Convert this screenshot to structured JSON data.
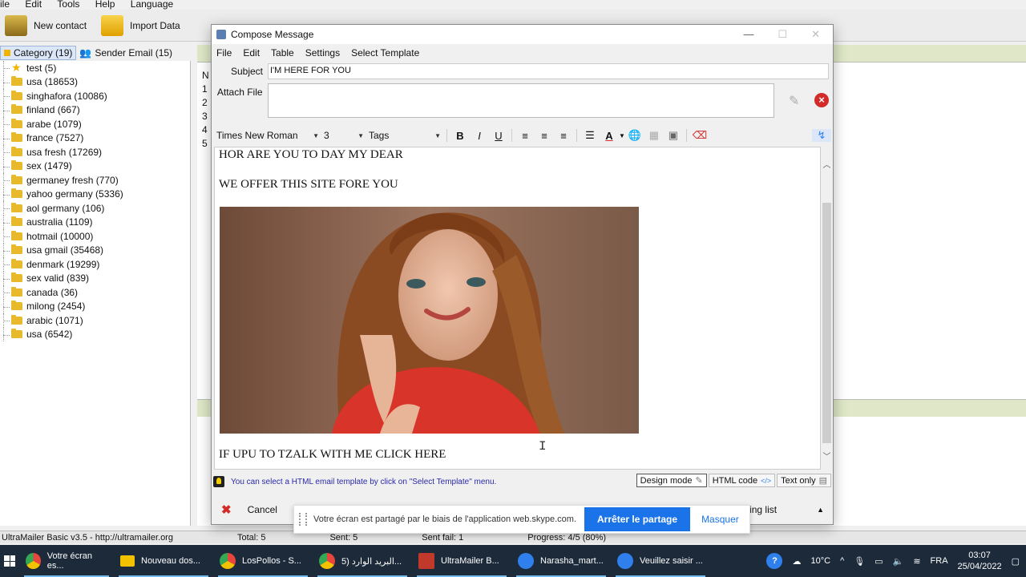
{
  "app_menu": [
    "ile",
    "Edit",
    "Tools",
    "Help",
    "Language"
  ],
  "app_toolbar": [
    {
      "label": "New contact",
      "icon": "new-contact-icon",
      "color": "#c8a43a"
    },
    {
      "label": "Import Data",
      "icon": "import-data-icon",
      "color": "#f2b400"
    }
  ],
  "left_tabs": [
    {
      "label": "Category (19)",
      "icon": "category-icon"
    },
    {
      "label": "Sender Email (15)",
      "icon": "sender-email-icon"
    }
  ],
  "categories": [
    {
      "label": "test  (5)",
      "icon": "star-icon"
    },
    {
      "label": "usa (18653)",
      "icon": "folder-icon"
    },
    {
      "label": "singhafora (10086)",
      "icon": "folder-icon"
    },
    {
      "label": "finland (667)",
      "icon": "folder-icon"
    },
    {
      "label": "arabe (1079)",
      "icon": "folder-icon"
    },
    {
      "label": "france (7527)",
      "icon": "folder-icon"
    },
    {
      "label": "usa fresh (17269)",
      "icon": "folder-icon"
    },
    {
      "label": "sex (1479)",
      "icon": "folder-icon"
    },
    {
      "label": "germaney fresh (770)",
      "icon": "folder-icon"
    },
    {
      "label": "yahoo germany (5336)",
      "icon": "folder-icon"
    },
    {
      "label": "aol germany (106)",
      "icon": "folder-icon"
    },
    {
      "label": "australia (1109)",
      "icon": "folder-icon"
    },
    {
      "label": "hotmail (10000)",
      "icon": "folder-icon"
    },
    {
      "label": "usa gmail (35468)",
      "icon": "folder-icon"
    },
    {
      "label": "denmark (19299)",
      "icon": "folder-icon"
    },
    {
      "label": "sex valid (839)",
      "icon": "folder-icon"
    },
    {
      "label": "canada  (36)",
      "icon": "folder-icon"
    },
    {
      "label": "milong (2454)",
      "icon": "folder-icon"
    },
    {
      "label": "arabic (1071)",
      "icon": "folder-icon"
    },
    {
      "label": "usa (6542)",
      "icon": "folder-icon"
    }
  ],
  "bg_rows": [
    "N",
    "1",
    "2",
    "3",
    "4",
    "5"
  ],
  "compose": {
    "title": "Compose Message",
    "menu": [
      "File",
      "Edit",
      "Table",
      "Settings",
      "Select Template"
    ],
    "subject_label": "Subject",
    "subject_value": "I'M HERE FOR YOU",
    "attach_label": "Attach File",
    "font_family": "Times New Roman",
    "font_size": "3",
    "tags_label": "Tags",
    "body_line1": "HOR ARE YOU TO DAY MY DEAR",
    "body_line2": "WE OFFER THIS SITE FORE YOU",
    "body_line3": "IF UPU TO TZALK  WITH ME CLICK HERE",
    "hint": "You can select a HTML email template by click on \"Select Template\" menu.",
    "modes": [
      "Design mode",
      "HTML code",
      "Text only"
    ],
    "cancel_label": "Cancel",
    "pending_label": "ending list"
  },
  "statusbar": {
    "app": "UltraMailer Basic v3.5 - http://ultramailer.org",
    "total": "Total: 5",
    "sent": "Sent: 5",
    "sent_fail": "Sent fail: 1",
    "progress": "Progress: 4/5 (80%)"
  },
  "skype": {
    "message": "Votre écran est partagé par le biais de l'application web.skype.com.",
    "stop_label": "Arrêter le partage",
    "hide_label": "Masquer"
  },
  "taskbar": {
    "tasks": [
      {
        "label": "Votre écran es...",
        "icon": "chrome-icon",
        "color": "#e8453c"
      },
      {
        "label": "Nouveau dos...",
        "icon": "folder-icon",
        "color": "#f2c200"
      },
      {
        "label": "LosPollos - S...",
        "icon": "chrome-icon",
        "color": "#e8453c"
      },
      {
        "label": "البريد الوارد (5...",
        "icon": "chrome-icon",
        "color": "#e8453c"
      },
      {
        "label": "UltraMailer B...",
        "icon": "ultramailer-icon",
        "color": "#c0392b"
      },
      {
        "label": "Narasha_mart...",
        "icon": "skype-icon",
        "color": "#2f80ed"
      },
      {
        "label": "Veuillez saisir ...",
        "icon": "security-icon",
        "color": "#2f80ed"
      }
    ],
    "temperature": "10°C",
    "language": "FRA",
    "time": "03:07",
    "date": "25/04/2022"
  }
}
